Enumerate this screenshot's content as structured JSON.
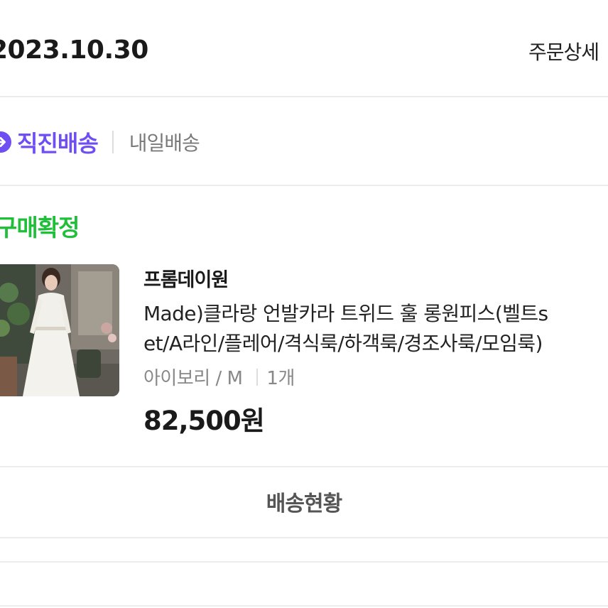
{
  "order": {
    "date": "2023.10.30",
    "detail_link": "주문상세"
  },
  "delivery": {
    "primary_label": "직진배송",
    "secondary_label": "내일배송",
    "badge_icon": "arrow-right-icon",
    "accent_color": "#6f4ef2"
  },
  "status": {
    "label": "구매확정",
    "color": "#1fbf3a"
  },
  "product": {
    "seller": "프롬데이원",
    "name_line1": "Made)클라랑 언발카라 트위드 훌 롱원피스(벨트s",
    "name_line2": "et/A라인/플레어/격식룩/하객룩/경조사룩/모임룩)",
    "option": "아이보리 / M",
    "quantity": "1개",
    "price": "82,500원",
    "image_alt": "white long dress product photo"
  },
  "actions": {
    "tracking_label": "배송현황"
  }
}
